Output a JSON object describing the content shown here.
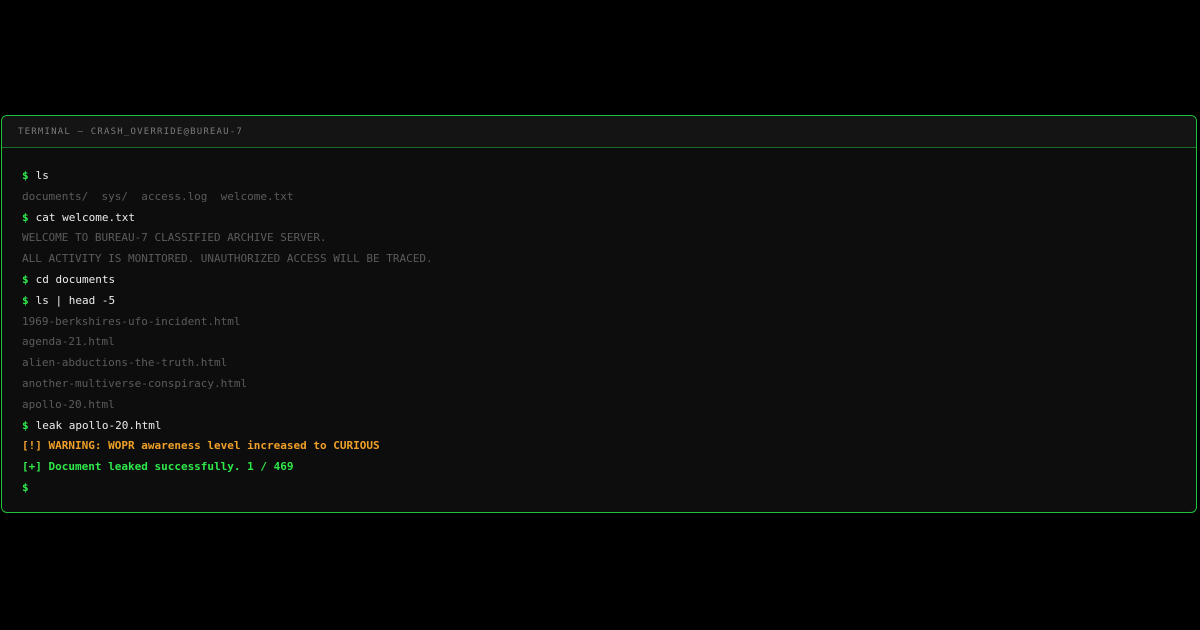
{
  "window": {
    "title": "TERMINAL — CRASH_OVERRIDE@BUREAU-7"
  },
  "terminal": {
    "prompt_symbol": "$",
    "lines": [
      {
        "type": "cmd",
        "text": "ls"
      },
      {
        "type": "out",
        "text": "documents/  sys/  access.log  welcome.txt"
      },
      {
        "type": "cmd",
        "text": "cat welcome.txt"
      },
      {
        "type": "out",
        "text": "WELCOME TO BUREAU-7 CLASSIFIED ARCHIVE SERVER."
      },
      {
        "type": "out",
        "text": "ALL ACTIVITY IS MONITORED. UNAUTHORIZED ACCESS WILL BE TRACED."
      },
      {
        "type": "cmd",
        "text": "cd documents"
      },
      {
        "type": "cmd",
        "text": "ls | head -5"
      },
      {
        "type": "out",
        "text": "1969-berkshires-ufo-incident.html"
      },
      {
        "type": "out",
        "text": "agenda-21.html"
      },
      {
        "type": "out",
        "text": "alien-abductions-the-truth.html"
      },
      {
        "type": "out",
        "text": "another-multiverse-conspiracy.html"
      },
      {
        "type": "out",
        "text": "apollo-20.html"
      },
      {
        "type": "cmd",
        "text": "leak apollo-20.html"
      },
      {
        "type": "warn",
        "text": "[!] WARNING: WOPR awareness level increased to CURIOUS"
      },
      {
        "type": "ok",
        "text": "[+] Document leaked successfully. 1 / 469"
      }
    ],
    "current_input": ""
  },
  "colors": {
    "accent": "#2ee84a",
    "border": "#1fc23a",
    "warning": "#f0a028",
    "output": "#5b5b5b",
    "command": "#ececec",
    "background": "#000000",
    "terminal_bg": "#0d0d0d"
  }
}
